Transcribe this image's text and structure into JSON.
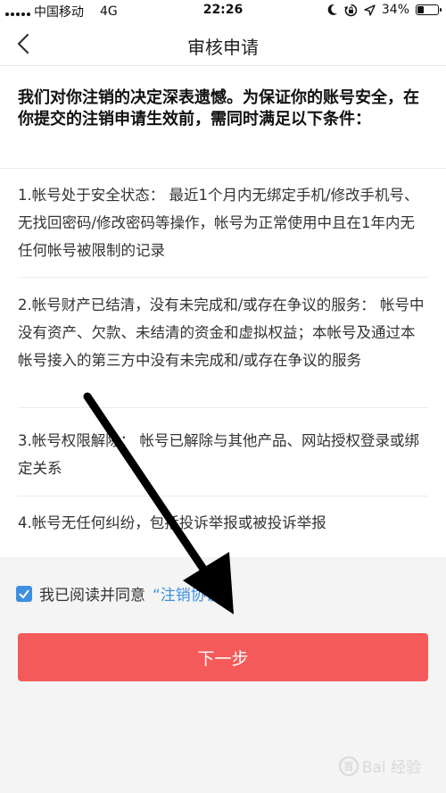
{
  "status_bar": {
    "carrier": "中国移动",
    "network": "4G",
    "time": "22:26",
    "battery_percent": "34%",
    "battery_level": 0.34
  },
  "nav": {
    "title": "审核申请"
  },
  "intro_text": "我们对你注销的决定深表遗憾。为保证你的账号安全，在你提交的注销申请生效前，需同时满足以下条件：",
  "conditions": [
    "1.帐号处于安全状态： 最近1个月内无绑定手机/修改手机号、无找回密码/修改密码等操作，帐号为正常使用中且在1年内无任何帐号被限制的记录",
    "2.帐号财产已结清，没有未完成和/或存在争议的服务： 帐号中没有资产、欠款、未结清的资金和虚拟权益；本帐号及通过本帐号接入的第三方中没有未完成和/或存在争议的服务",
    "3.帐号权限解除： 帐号已解除与其他产品、网站授权登录或绑定关系",
    "4.帐号无任何纠纷，包括投诉举报或被投诉举报"
  ],
  "agreement": {
    "text": "我已阅读并同意",
    "link": "“注销协议”",
    "checked": true
  },
  "next_button": "下一步",
  "watermark": "Bai 经验",
  "colors": {
    "accent_blue": "#3d8fe0",
    "button_red": "#f55a5a",
    "bottom_bg": "#f4f4f4"
  },
  "icons": [
    "back-chevron-icon",
    "checkmark-icon",
    "moon-icon",
    "lock-rotation-icon",
    "location-arrow-icon",
    "battery-icon",
    "annotation-arrow"
  ]
}
